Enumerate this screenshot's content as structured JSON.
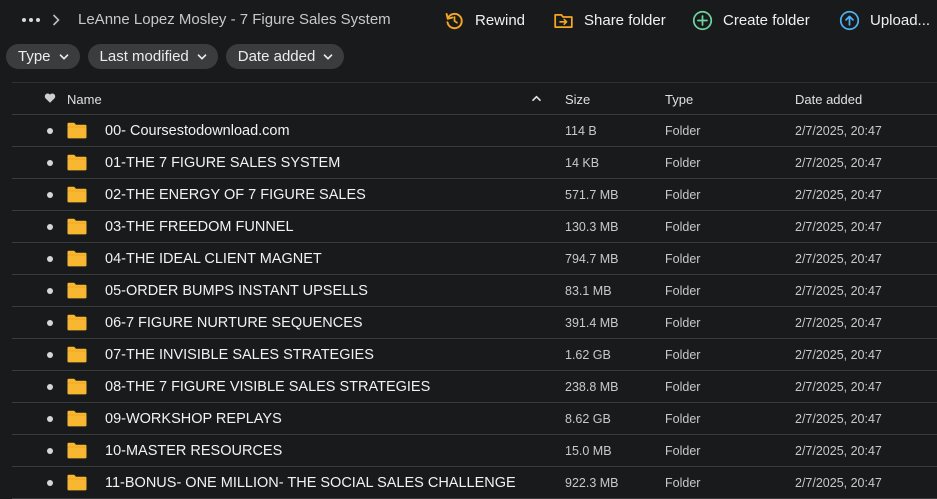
{
  "breadcrumb": {
    "title": "LeAnne Lopez Mosley - 7 Figure Sales System"
  },
  "actions": {
    "rewind": "Rewind",
    "share": "Share folder",
    "create": "Create folder",
    "upload": "Upload..."
  },
  "filters": {
    "type": "Type",
    "last_modified": "Last modified",
    "date_added": "Date added"
  },
  "columns": {
    "name": "Name",
    "size": "Size",
    "type": "Type",
    "date": "Date added"
  },
  "colors": {
    "accent_orange": "#f5a623",
    "accent_green": "#6fd3a0",
    "accent_blue": "#4fb0f0",
    "folder": "#f7b731"
  },
  "rows": [
    {
      "name": "00- Coursestodownload.com",
      "size": "114 B",
      "type": "Folder",
      "date": "2/7/2025, 20:47"
    },
    {
      "name": "01-THE 7 FIGURE SALES SYSTEM",
      "size": "14 KB",
      "type": "Folder",
      "date": "2/7/2025, 20:47"
    },
    {
      "name": "02-THE ENERGY OF 7 FIGURE SALES",
      "size": "571.7 MB",
      "type": "Folder",
      "date": "2/7/2025, 20:47"
    },
    {
      "name": "03-THE FREEDOM FUNNEL",
      "size": "130.3 MB",
      "type": "Folder",
      "date": "2/7/2025, 20:47"
    },
    {
      "name": "04-THE IDEAL CLIENT MAGNET",
      "size": "794.7 MB",
      "type": "Folder",
      "date": "2/7/2025, 20:47"
    },
    {
      "name": "05-ORDER BUMPS INSTANT UPSELLS",
      "size": "83.1 MB",
      "type": "Folder",
      "date": "2/7/2025, 20:47"
    },
    {
      "name": "06-7 FIGURE NURTURE SEQUENCES",
      "size": "391.4 MB",
      "type": "Folder",
      "date": "2/7/2025, 20:47"
    },
    {
      "name": "07-THE INVISIBLE SALES STRATEGIES",
      "size": "1.62 GB",
      "type": "Folder",
      "date": "2/7/2025, 20:47"
    },
    {
      "name": "08-THE 7 FIGURE VISIBLE SALES STRATEGIES",
      "size": "238.8 MB",
      "type": "Folder",
      "date": "2/7/2025, 20:47"
    },
    {
      "name": "09-WORKSHOP REPLAYS",
      "size": "8.62 GB",
      "type": "Folder",
      "date": "2/7/2025, 20:47"
    },
    {
      "name": "10-MASTER RESOURCES",
      "size": "15.0 MB",
      "type": "Folder",
      "date": "2/7/2025, 20:47"
    },
    {
      "name": "11-BONUS- ONE MILLION- THE SOCIAL SALES CHALLENGE",
      "size": "922.3 MB",
      "type": "Folder",
      "date": "2/7/2025, 20:47"
    }
  ]
}
